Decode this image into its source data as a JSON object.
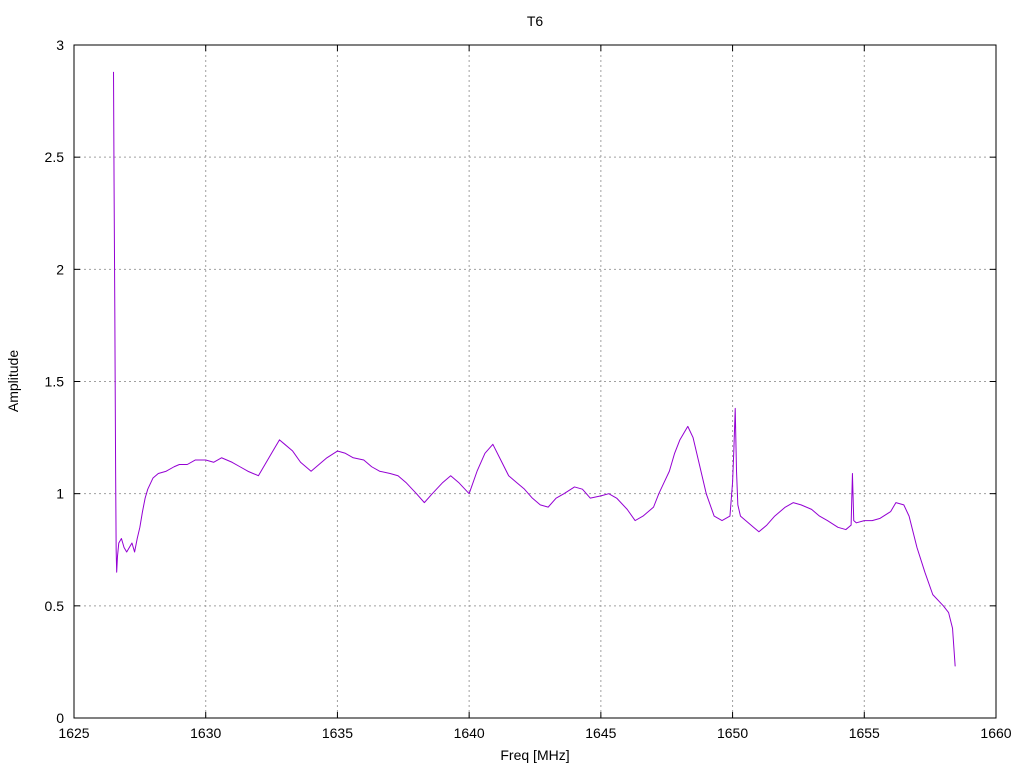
{
  "chart_data": {
    "type": "line",
    "title": "T6",
    "xlabel": "Freq [MHz]",
    "ylabel": "Amplitude",
    "xlim": [
      1625,
      1660
    ],
    "ylim": [
      0,
      3
    ],
    "grid": true,
    "xticks": [
      1625,
      1630,
      1635,
      1640,
      1645,
      1650,
      1655,
      1660
    ],
    "xtick_labels": [
      "1625",
      "1630",
      "1635",
      "1640",
      "1645",
      "1650",
      "1655",
      "1660"
    ],
    "yticks": [
      0,
      0.5,
      1,
      1.5,
      2,
      2.5,
      3
    ],
    "ytick_labels": [
      "0",
      "0.5",
      "1",
      "1.5",
      "2",
      "2.5",
      "3"
    ],
    "series": [
      {
        "color": "#9400d3",
        "x": [
          1626.5,
          1626.52,
          1626.55,
          1626.58,
          1626.6,
          1626.62,
          1626.65,
          1626.7,
          1626.8,
          1626.9,
          1627.0,
          1627.1,
          1627.2,
          1627.3,
          1627.4,
          1627.5,
          1627.6,
          1627.7,
          1627.8,
          1628.0,
          1628.2,
          1628.5,
          1628.8,
          1629.0,
          1629.3,
          1629.6,
          1630.0,
          1630.3,
          1630.6,
          1631.0,
          1631.3,
          1631.6,
          1632.0,
          1632.3,
          1632.6,
          1632.8,
          1633.0,
          1633.3,
          1633.6,
          1634.0,
          1634.3,
          1634.6,
          1635.0,
          1635.3,
          1635.6,
          1636.0,
          1636.3,
          1636.6,
          1637.0,
          1637.3,
          1637.6,
          1638.0,
          1638.3,
          1638.6,
          1639.0,
          1639.3,
          1639.6,
          1640.0,
          1640.3,
          1640.6,
          1640.9,
          1641.2,
          1641.5,
          1641.8,
          1642.1,
          1642.4,
          1642.7,
          1643.0,
          1643.3,
          1643.6,
          1644.0,
          1644.3,
          1644.6,
          1645.0,
          1645.3,
          1645.6,
          1646.0,
          1646.3,
          1646.6,
          1647.0,
          1647.2,
          1647.4,
          1647.6,
          1647.8,
          1648.0,
          1648.2,
          1648.3,
          1648.5,
          1648.7,
          1649.0,
          1649.3,
          1649.6,
          1649.9,
          1650.0,
          1650.05,
          1650.1,
          1650.15,
          1650.2,
          1650.3,
          1650.5,
          1650.8,
          1651.0,
          1651.3,
          1651.6,
          1652.0,
          1652.3,
          1652.6,
          1653.0,
          1653.3,
          1653.6,
          1654.0,
          1654.3,
          1654.5,
          1654.55,
          1654.6,
          1654.7,
          1655.0,
          1655.3,
          1655.6,
          1656.0,
          1656.2,
          1656.5,
          1656.7,
          1657.0,
          1657.3,
          1657.6,
          1658.0,
          1658.2,
          1658.35,
          1658.45
        ],
        "y": [
          2.88,
          2.4,
          1.8,
          1.1,
          0.75,
          0.65,
          0.72,
          0.78,
          0.8,
          0.76,
          0.74,
          0.76,
          0.78,
          0.74,
          0.8,
          0.85,
          0.92,
          0.98,
          1.02,
          1.07,
          1.09,
          1.1,
          1.12,
          1.13,
          1.13,
          1.15,
          1.15,
          1.14,
          1.16,
          1.14,
          1.12,
          1.1,
          1.08,
          1.14,
          1.2,
          1.24,
          1.22,
          1.19,
          1.14,
          1.1,
          1.13,
          1.16,
          1.19,
          1.18,
          1.16,
          1.15,
          1.12,
          1.1,
          1.09,
          1.08,
          1.05,
          1.0,
          0.96,
          1.0,
          1.05,
          1.08,
          1.05,
          1.0,
          1.1,
          1.18,
          1.22,
          1.15,
          1.08,
          1.05,
          1.02,
          0.98,
          0.95,
          0.94,
          0.98,
          1.0,
          1.03,
          1.02,
          0.98,
          0.99,
          1.0,
          0.98,
          0.93,
          0.88,
          0.9,
          0.94,
          1.0,
          1.05,
          1.1,
          1.18,
          1.24,
          1.28,
          1.3,
          1.25,
          1.15,
          1.0,
          0.9,
          0.88,
          0.9,
          1.05,
          1.2,
          1.38,
          1.1,
          0.95,
          0.9,
          0.88,
          0.85,
          0.83,
          0.86,
          0.9,
          0.94,
          0.96,
          0.95,
          0.93,
          0.9,
          0.88,
          0.85,
          0.84,
          0.86,
          1.09,
          0.88,
          0.87,
          0.88,
          0.88,
          0.89,
          0.92,
          0.96,
          0.95,
          0.9,
          0.76,
          0.65,
          0.55,
          0.5,
          0.47,
          0.4,
          0.23
        ]
      }
    ]
  }
}
